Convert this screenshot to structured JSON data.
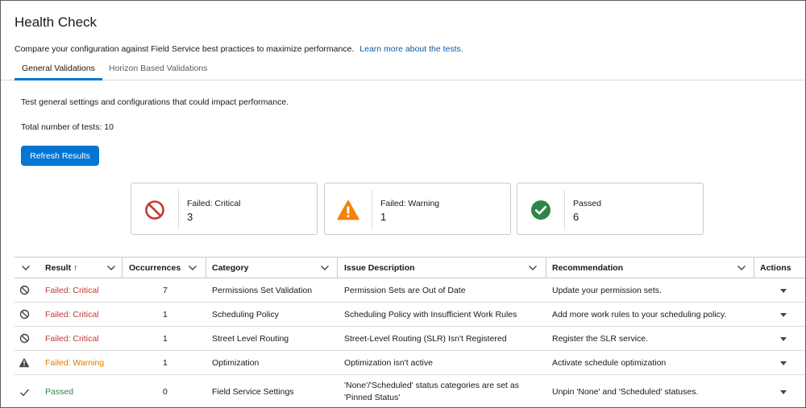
{
  "page": {
    "title": "Health Check",
    "subtitle": "Compare your configuration against Field Service best practices to maximize performance.",
    "learn_more": "Learn more about the tests."
  },
  "tabs": [
    {
      "label": "General Validations",
      "active": true
    },
    {
      "label": "Horizon Based Validations",
      "active": false
    }
  ],
  "intro": "Test general settings and configurations that could impact performance.",
  "total_tests": "Total number of tests: 10",
  "refresh_label": "Refresh Results",
  "summary": {
    "critical": {
      "label": "Failed: Critical",
      "value": "3",
      "icon": "prohibited-icon",
      "color": "#c23934"
    },
    "warning": {
      "label": "Failed: Warning",
      "value": "1",
      "icon": "warning-icon",
      "color": "#f38303"
    },
    "passed": {
      "label": "Passed",
      "value": "6",
      "icon": "check-circle-icon",
      "color": "#2e844a"
    }
  },
  "table": {
    "headers": {
      "result": "Result ↑",
      "occurrences": "Occurrences",
      "category": "Category",
      "issue": "Issue Description",
      "recommendation": "Recommendation",
      "actions": "Actions"
    },
    "rows": [
      {
        "status": "critical",
        "result": "Failed: Critical",
        "occurrences": "7",
        "category": "Permissions Set Validation",
        "issue": "Permission Sets are Out of Date",
        "recommendation": "Update your permission sets."
      },
      {
        "status": "critical",
        "result": "Failed: Critical",
        "occurrences": "1",
        "category": "Scheduling Policy",
        "issue": "Scheduling Policy with Insufficient Work Rules",
        "recommendation": "Add more work rules to your scheduling policy."
      },
      {
        "status": "critical",
        "result": "Failed: Critical",
        "occurrences": "1",
        "category": "Street Level Routing",
        "issue": "Street-Level Routing (SLR) Isn't Registered",
        "recommendation": "Register the SLR service."
      },
      {
        "status": "warning",
        "result": "Failed: Warning",
        "occurrences": "1",
        "category": "Optimization",
        "issue": "Optimization isn't active",
        "recommendation": "Activate schedule optimization"
      },
      {
        "status": "passed",
        "result": "Passed",
        "occurrences": "0",
        "category": "Field Service Settings",
        "issue_line1": "'None'/'Scheduled' status categories are set as",
        "issue_line2": "'Pinned Status'",
        "recommendation": "Unpin 'None' and 'Scheduled' statuses."
      }
    ]
  }
}
